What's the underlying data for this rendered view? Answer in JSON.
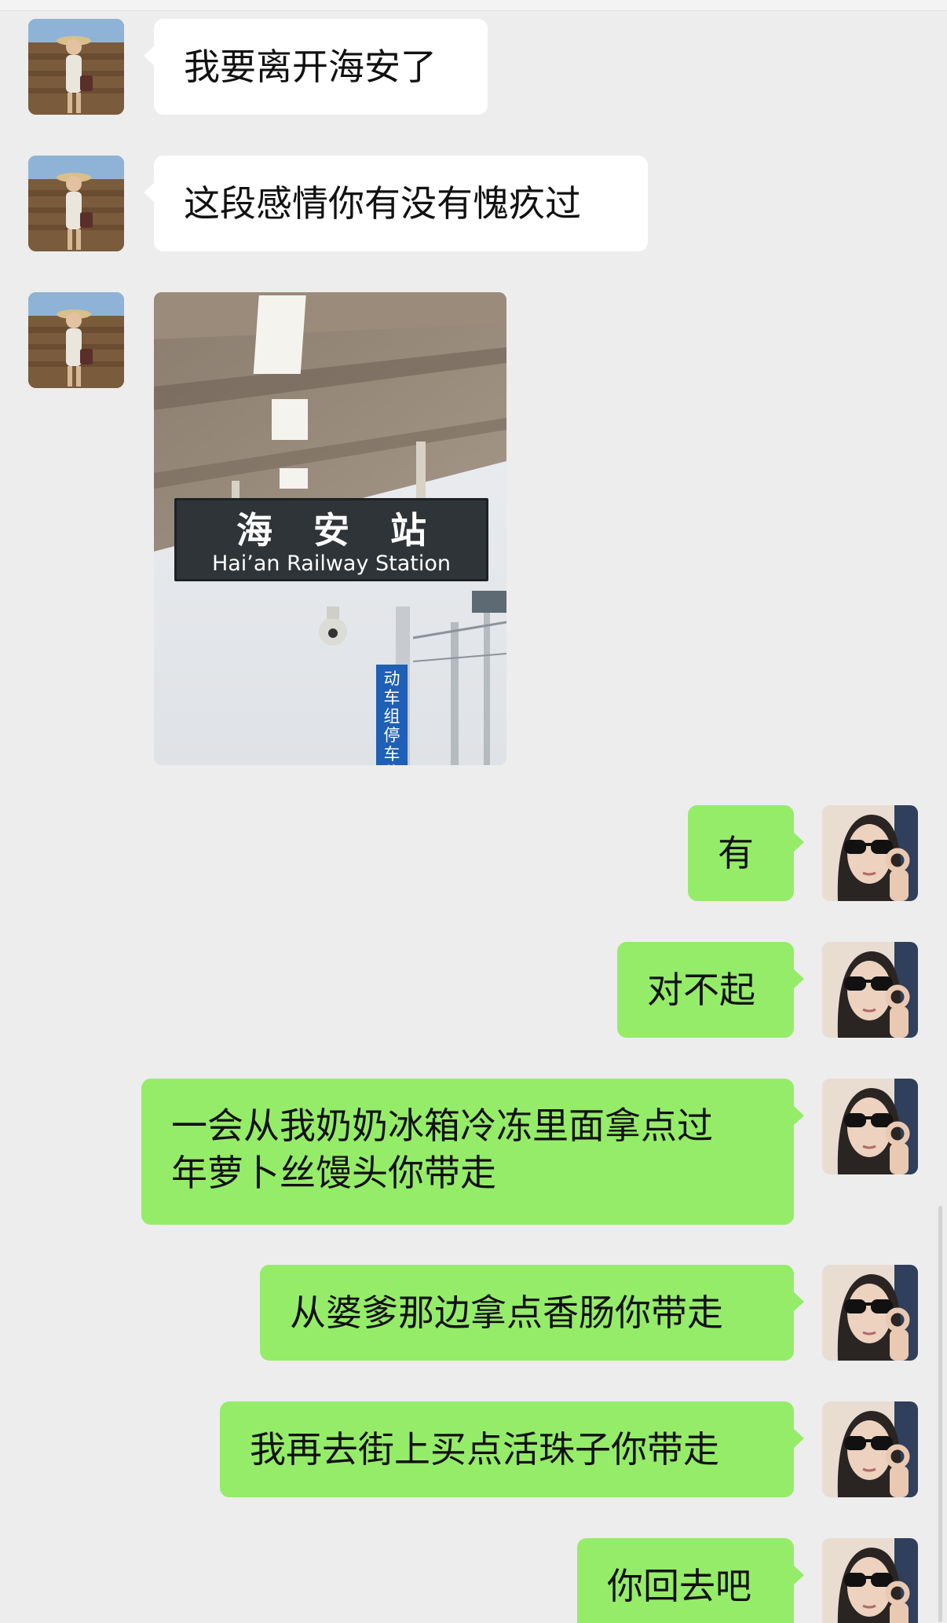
{
  "chat": {
    "messages": [
      {
        "side": "in",
        "text": "我要离开海安了"
      },
      {
        "side": "in",
        "text": "这段感情你有没有愧疚过"
      },
      {
        "side": "in",
        "image": true,
        "sign_zh": "海 安 站",
        "sign_en": "Hai’an Railway Station",
        "platform_sign": "动车组停车位"
      },
      {
        "side": "out",
        "text": "有"
      },
      {
        "side": "out",
        "text": "对不起"
      },
      {
        "side": "out",
        "lines": [
          "一会从我奶奶冰箱冷冻里面拿点过",
          "年萝卜丝馒头你带走"
        ]
      },
      {
        "side": "out",
        "text": "从婆爹那边拿点香肠你带走"
      },
      {
        "side": "out",
        "text": "我再去街上买点活珠子你带走"
      },
      {
        "side": "out",
        "text": "你回去吧"
      }
    ]
  },
  "colors": {
    "background": "#ededed",
    "incoming_bubble": "#ffffff",
    "outgoing_bubble": "#95ec69"
  }
}
